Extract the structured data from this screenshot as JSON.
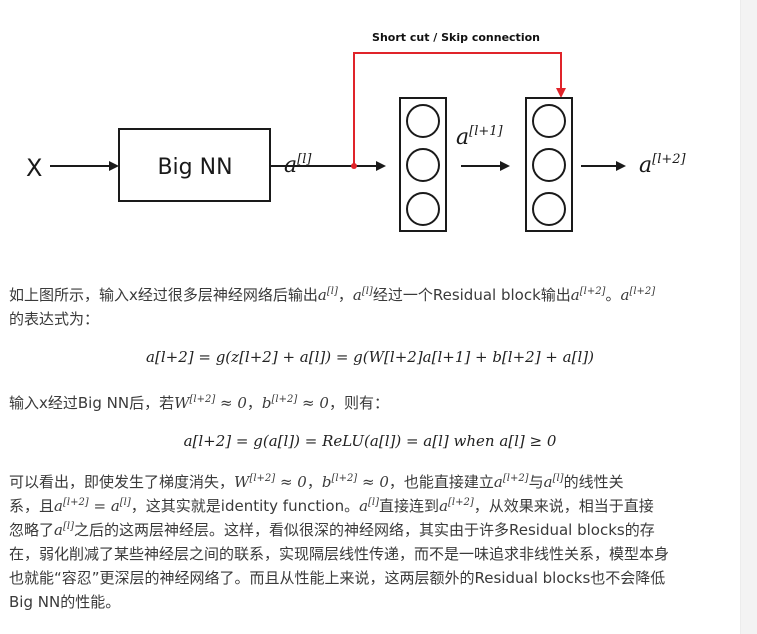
{
  "diagram": {
    "input_label": "X",
    "block_label": "Big NN",
    "skip_label": "Short cut / Skip connection",
    "a_l": "a",
    "a_l_sup": "[l]",
    "a_l1": "a",
    "a_l1_sup": "[l+1]",
    "a_l2": "a",
    "a_l2_sup": "[l+2]",
    "colors": {
      "skip_arrow": "#e0242a",
      "ink": "#1a1a1a"
    }
  },
  "p1": {
    "t1": "如上图所示，输入x经过很多层神经网络后输出",
    "t2": "，",
    "t3": "经过一个Residual block输出",
    "t4": "。",
    "line2": "的表达式为："
  },
  "eq1": "a[l+2] = g(z[l+2] + a[l]) = g(W[l+2]a[l+1] + b[l+2] + a[l])",
  "p2": {
    "t1": "输入x经过Big NN后，若",
    "t2": "，",
    "t3": "，则有："
  },
  "eq2": "a[l+2] = g(a[l]) = ReLU(a[l]) = a[l]    when a[l] ≥ 0",
  "p3": {
    "l1a": "可以看出，即使发生了梯度消失，",
    "l1b": "，",
    "l1c": "，也能直接建立",
    "l1d": "与",
    "l1e": "的线性关",
    "l2a": "系，且",
    "l2b": "，这其实就是identity function。",
    "l2c": "直接连到",
    "l2d": "，从效果来说，相当于直接",
    "l3a": "忽略了",
    "l3b": "之后的这两层神经层。这样，看似很深的神经网络，其实由于许多Residual blocks的存",
    "l4": "在，弱化削减了某些神经层之间的联系，实现隔层线性传递，而不是一味追求非线性关系，模型本身",
    "l5": "也就能“容忍”更深层的神经网络了。而且从性能上来说，这两层额外的Residual blocks也不会降低",
    "l6": "Big NN的性能。"
  }
}
